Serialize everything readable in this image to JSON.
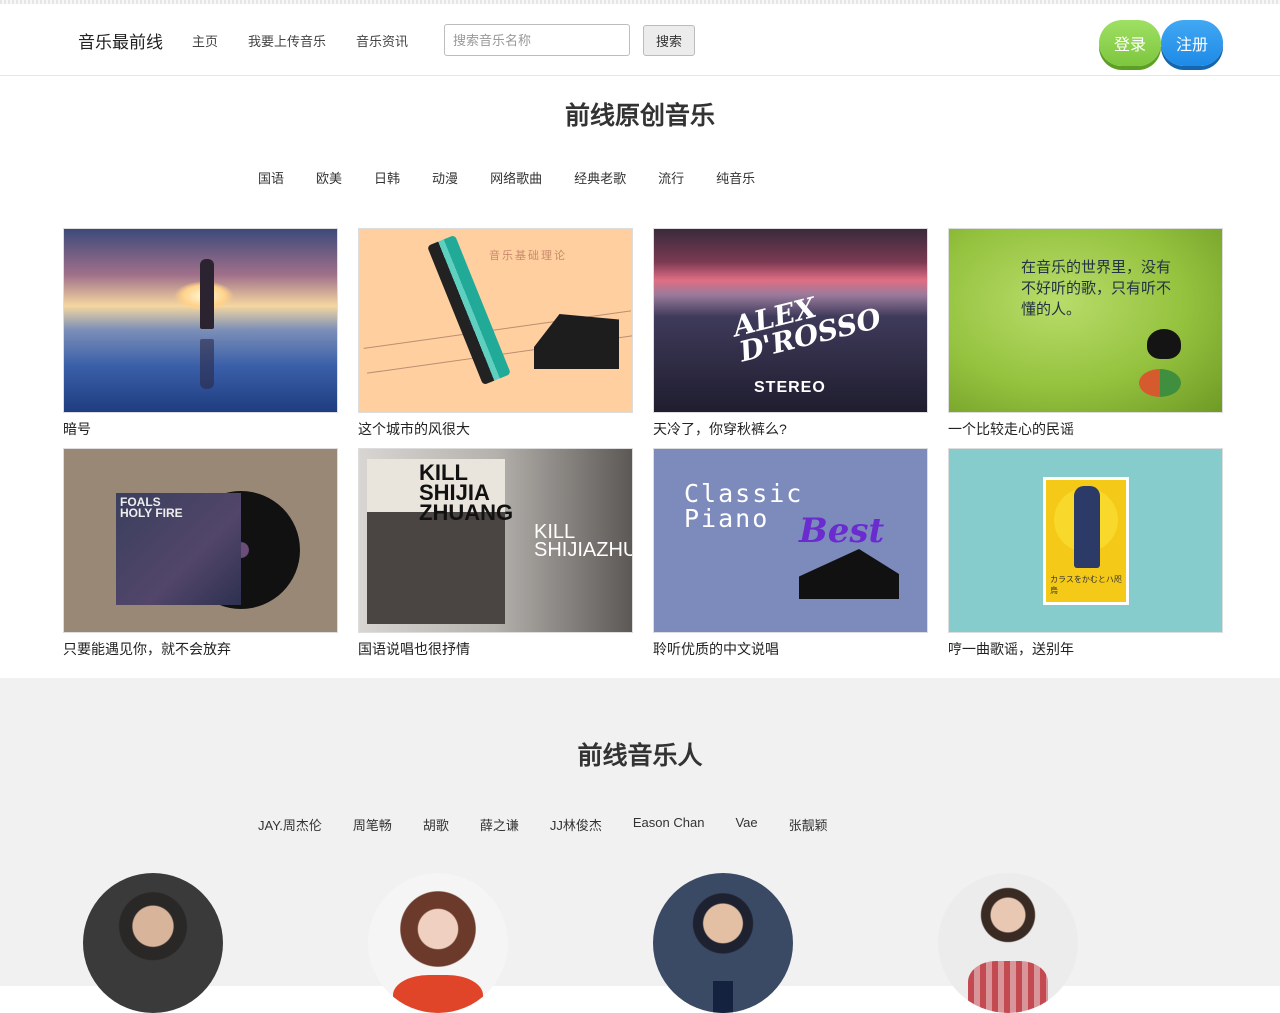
{
  "header": {
    "brand": "音乐最前线",
    "nav": [
      "主页",
      "我要上传音乐",
      "音乐资讯"
    ],
    "search_placeholder": "搜索音乐名称",
    "search_button": "搜索",
    "login_button": "登录",
    "register_button": "注册"
  },
  "section_originals": {
    "title": "前线原创音乐",
    "categories": [
      "国语",
      "欧美",
      "日韩",
      "动漫",
      "网络歌曲",
      "经典老歌",
      "流行",
      "纯音乐"
    ],
    "cards": [
      {
        "caption": "暗号"
      },
      {
        "caption": "这个城市的风很大",
        "art_text": "音乐基础理论"
      },
      {
        "caption": "天冷了，你穿秋裤么?",
        "art_text": "ALEX D'ROSSO",
        "art_sub": "STEREO"
      },
      {
        "caption": "一个比较走心的民谣",
        "art_text": "在音乐的世界里，没有不好听的歌，只有听不懂的人。"
      },
      {
        "caption": "只要能遇见你，就不会放弃",
        "art_text": "FOALS HOLY FIRE"
      },
      {
        "caption": "国语说唱也很抒情",
        "art_text": "KILL SHIJIA ZHUANG",
        "art_sub": "KILL SHIJIAZHUANG"
      },
      {
        "caption": "聆听优质的中文说唱",
        "art_text": "Classic Piano",
        "art_sub": "Best"
      },
      {
        "caption": "哼一曲歌谣，送别年",
        "art_text": "カラスをかむとハ咫烏"
      }
    ]
  },
  "section_artists": {
    "title": "前线音乐人",
    "artists": [
      "JAY.周杰伦",
      "周笔畅",
      "胡歌",
      "薛之谦",
      "JJ林俊杰",
      "Eason Chan",
      "Vae",
      "张靓颖"
    ]
  },
  "colors": {
    "login": "#8bd14c",
    "register": "#2196f3",
    "band_bg": "#f1f1f1"
  }
}
